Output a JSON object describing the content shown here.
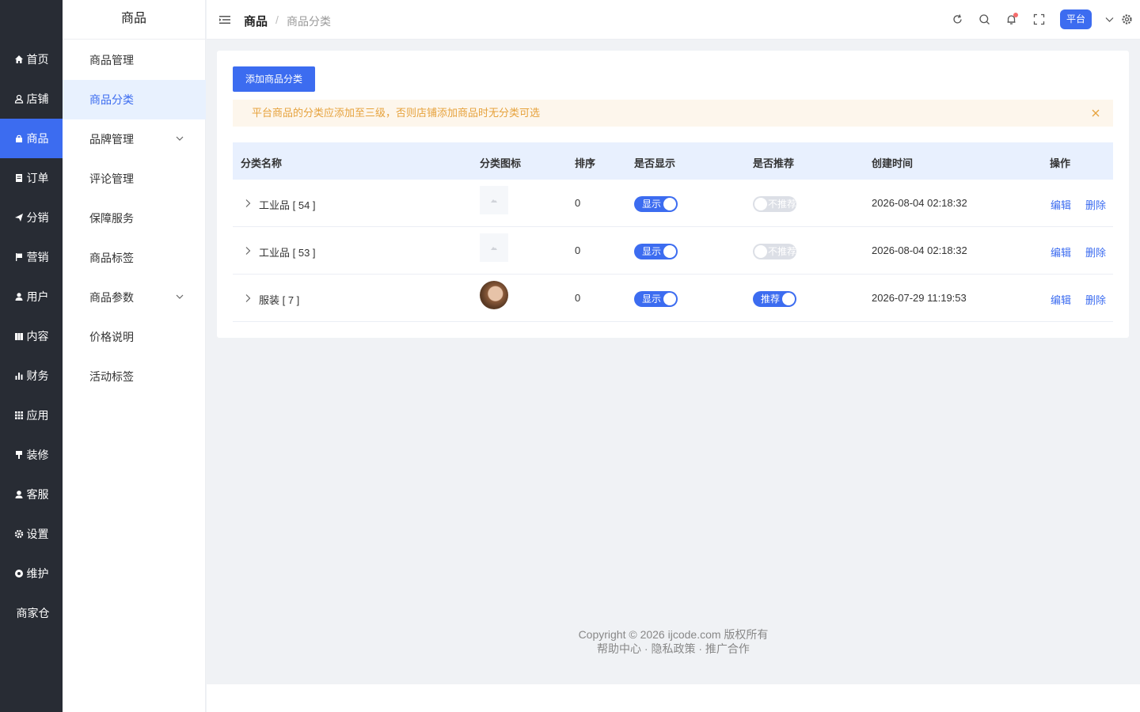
{
  "rail": {
    "items": [
      {
        "label": "首页",
        "icon": "home-icon"
      },
      {
        "label": "店铺",
        "icon": "user-outline-icon"
      },
      {
        "label": "商品",
        "icon": "lock-bag-icon"
      },
      {
        "label": "订单",
        "icon": "document-icon"
      },
      {
        "label": "分销",
        "icon": "send-icon"
      },
      {
        "label": "营销",
        "icon": "flag-icon"
      },
      {
        "label": "用户",
        "icon": "user-icon"
      },
      {
        "label": "内容",
        "icon": "book-icon"
      },
      {
        "label": "财务",
        "icon": "bar-chart-icon"
      },
      {
        "label": "应用",
        "icon": "grid-icon"
      },
      {
        "label": "装修",
        "icon": "brush-icon"
      },
      {
        "label": "客服",
        "icon": "headset-icon"
      },
      {
        "label": "设置",
        "icon": "gear-icon"
      },
      {
        "label": "维护",
        "icon": "tool-icon"
      },
      {
        "label": "商家仓",
        "icon": ""
      }
    ],
    "active_index": 2,
    "active_color": "#3c6cf0"
  },
  "submenu": {
    "title": "商品",
    "items": [
      {
        "label": "商品管理"
      },
      {
        "label": "商品分类"
      },
      {
        "label": "品牌管理"
      },
      {
        "label": "评论管理"
      },
      {
        "label": "保障服务"
      },
      {
        "label": "商品标签"
      },
      {
        "label": "商品参数"
      },
      {
        "label": "价格说明"
      },
      {
        "label": "活动标签"
      }
    ]
  },
  "header": {
    "breadcrumb_main": "商品",
    "breadcrumb_sep": "/",
    "breadcrumb_sub": "商品分类",
    "platform_label": "平台"
  },
  "main": {
    "add_button": "添加商品分类",
    "alert_text": "平台商品的分类应添加至三级，否则店铺添加商品时无分类可选",
    "columns": [
      "分类名称",
      "分类图标",
      "排序",
      "是否显示",
      "是否推荐",
      "创建时间",
      "操作"
    ],
    "rows": [
      {
        "name": "工业品 [ 54 ]",
        "sort": "0",
        "show_label": "显示",
        "show_on": true,
        "recommend_label": "不推荐",
        "recommend_on": false,
        "created": "2026-08-04 02:18:32",
        "edit": "编辑",
        "delete": "删除"
      },
      {
        "name": "工业品 [ 53 ]",
        "sort": "0",
        "show_label": "显示",
        "show_on": true,
        "recommend_label": "不推荐",
        "recommend_on": false,
        "created": "2026-08-04 02:18:32",
        "edit": "编辑",
        "delete": "删除"
      },
      {
        "name": "服装 [ 7 ]",
        "sort": "0",
        "show_label": "显示",
        "show_on": true,
        "recommend_label": "推荐",
        "recommend_on": true,
        "created": "2026-07-29 11:19:53",
        "edit": "编辑",
        "delete": "删除"
      }
    ]
  },
  "footer": {
    "copyright": "Copyright © 2026 ijcode.com 版权所有",
    "links": "帮助中心 · 隐私政策 · 推广合作"
  }
}
